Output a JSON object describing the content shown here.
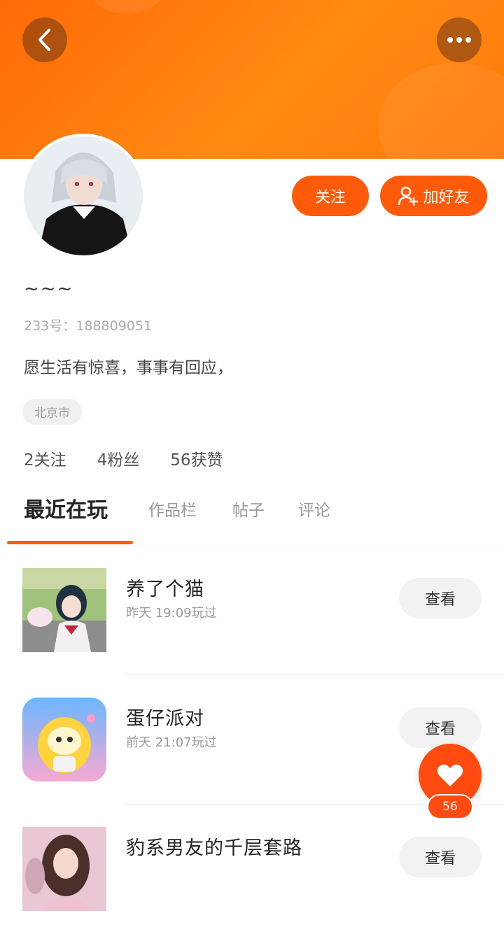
{
  "header": {
    "back_icon": "chevron-left-icon",
    "more_icon": "more-dots-icon"
  },
  "profile": {
    "nickname": "~~~",
    "uid": "233号：188809051",
    "bio": "愿生活有惊喜，事事有回应，",
    "location": "北京市",
    "follow_label": "关注",
    "add_friend_label": "加好友",
    "stats": [
      "2关注",
      "4粉丝",
      "56获赞"
    ]
  },
  "tabs": [
    "最近在玩",
    "作品栏",
    "帖子",
    "评论"
  ],
  "games": [
    {
      "title": "养了个猫",
      "time": "昨天 19:09玩过",
      "button": "查看"
    },
    {
      "title": "蛋仔派对",
      "time": "前天 21:07玩过",
      "button": "查看"
    },
    {
      "title": "豹系男友的千层套路",
      "time": "",
      "button": "查看"
    }
  ],
  "like": {
    "count": "56"
  },
  "colors": {
    "accent": "#ff5a0a",
    "banner": "#ff7a0c"
  }
}
